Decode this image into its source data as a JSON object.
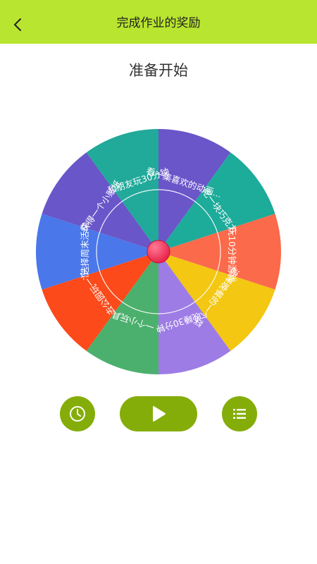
{
  "header": {
    "title": "完成作业的奖励",
    "bg_color": "#b8e52f"
  },
  "status": {
    "text": "准备开始"
  },
  "wheel": {
    "segments": [
      {
        "label": "看一集喜欢的动画...",
        "color": "#6a55c9"
      },
      {
        "label": "吃一块巧克力",
        "color": "#1dab9a"
      },
      {
        "label": "玩10分钟游戏",
        "color": "#fb6a4a"
      },
      {
        "label": "选择晚餐的一个菜",
        "color": "#f3c712"
      },
      {
        "label": "晚睡30分钟",
        "color": "#9e7ce5"
      },
      {
        "label": "一个小玩具",
        "color": "#4bb06d"
      },
      {
        "label": "去公园玩一次",
        "color": "#fc4a1a"
      },
      {
        "label": "选择周末活动",
        "color": "#4a77ea"
      },
      {
        "label": "获得一个小贴纸",
        "color": "#6956c9"
      },
      {
        "label": "和朋友玩30分钟",
        "color": "#21a99a"
      }
    ],
    "hub_color": "#e8234a"
  },
  "controls": {
    "accent": "#84ad0a",
    "icons": [
      "clock-icon",
      "play-icon",
      "list-icon"
    ]
  }
}
